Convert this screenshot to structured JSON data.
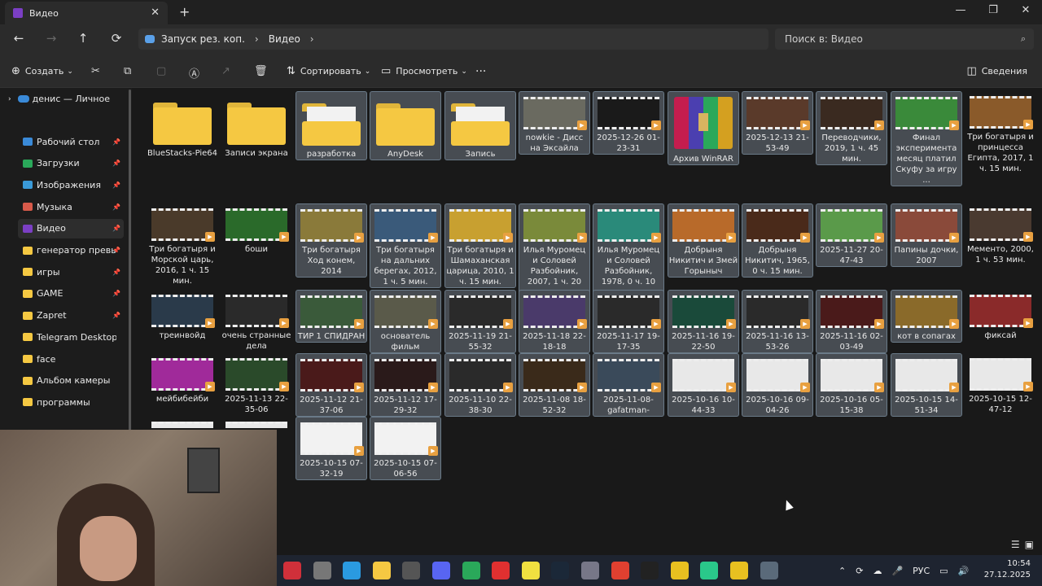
{
  "tab": {
    "title": "Видео",
    "close": "✕",
    "new": "+"
  },
  "window_controls": {
    "min": "—",
    "max": "❐",
    "close": "✕"
  },
  "nav": {
    "back": "←",
    "forward": "→",
    "up": "↑",
    "refresh": "⟳"
  },
  "breadcrumb": {
    "items": [
      "Запуск рез. коп.",
      "Видео"
    ],
    "sep": "›",
    "trail": "›"
  },
  "search": {
    "placeholder": "Поиск в: Видео",
    "icon": "⌕"
  },
  "toolbar": {
    "create": "Создать",
    "sort": "Сортировать",
    "view": "Просмотреть",
    "more": "···",
    "details": "Сведения",
    "caret": "⌄"
  },
  "sidebar": {
    "top": "денис — Личное",
    "items": [
      {
        "label": "Рабочий стол",
        "color": "#3a8ad8",
        "pin": true
      },
      {
        "label": "Загрузки",
        "color": "#2aa85a",
        "pin": true
      },
      {
        "label": "Изображения",
        "color": "#3a9ad8",
        "pin": true
      },
      {
        "label": "Музыка",
        "color": "#d85a4a",
        "pin": true
      },
      {
        "label": "Видео",
        "color": "#7b3fc4",
        "pin": true,
        "selected": true
      },
      {
        "label": "генератор превью к",
        "color": "#f5c842",
        "pin": true
      },
      {
        "label": "игры",
        "color": "#f5c842",
        "pin": true
      },
      {
        "label": "GAME",
        "color": "#f5c842",
        "pin": true
      },
      {
        "label": "Zapret",
        "color": "#f5c842",
        "pin": true
      },
      {
        "label": "Telegram Desktop",
        "color": "#f5c842",
        "pin": false
      },
      {
        "label": "face",
        "color": "#f5c842",
        "pin": false
      },
      {
        "label": "Альбом камеры",
        "color": "#f5c842",
        "pin": false
      },
      {
        "label": "программы",
        "color": "#f5c842",
        "pin": false
      }
    ],
    "pin_glyph": "📌"
  },
  "files": [
    {
      "name": "BlueStacks-Pie64",
      "kind": "folder",
      "sel": false
    },
    {
      "name": "Записи экрана",
      "kind": "folder",
      "sel": false
    },
    {
      "name": "разработка",
      "kind": "folder-doc",
      "sel": true
    },
    {
      "name": "AnyDesk",
      "kind": "folder",
      "sel": true
    },
    {
      "name": "Запись",
      "kind": "folder-doc",
      "sel": true
    },
    {
      "name": "nowkie - Дисс на Эксайла",
      "kind": "video",
      "sel": true,
      "tint": "#6a6a60"
    },
    {
      "name": "2025-12-26 01-23-31",
      "kind": "video",
      "sel": true,
      "tint": "#1a1a1a"
    },
    {
      "name": "Архив WinRAR",
      "kind": "rar",
      "sel": true
    },
    {
      "name": "2025-12-13 21-53-49",
      "kind": "video",
      "sel": true,
      "tint": "#5a3a2a"
    },
    {
      "name": "Переводчики, 2019, 1 ч. 45 мин.",
      "kind": "video",
      "sel": true,
      "tint": "#3a2a20"
    },
    {
      "name": "Финал эксперимента месяц платил Скуфу за игру ...",
      "kind": "video",
      "sel": true,
      "tint": "#3a8a3a"
    },
    {
      "name": "Три богатыря и принцесса Египта, 2017, 1 ч. 15 мин.",
      "kind": "video",
      "sel": false,
      "tint": "#8a5a2a"
    },
    {
      "name": "Три богатыря и Морской царь, 2016, 1 ч. 15 мин.",
      "kind": "video",
      "sel": false,
      "tint": "#4a3a2a"
    },
    {
      "name": "боши",
      "kind": "video",
      "sel": false,
      "tint": "#2a6a2a"
    },
    {
      "name": "Три богатыря Ход конем, 2014",
      "kind": "video",
      "sel": true,
      "tint": "#8a7a3a"
    },
    {
      "name": "Три богатыря на дальних берегах, 2012, 1 ч. 5 мин.",
      "kind": "video",
      "sel": true,
      "tint": "#3a5a7a"
    },
    {
      "name": "Три богатыря и Шамаханская царица, 2010, 1 ч. 15 мин.",
      "kind": "video",
      "sel": true,
      "tint": "#c8a030"
    },
    {
      "name": "Илья Муромец и Соловей Разбойник, 2007, 1 ч. 20 м...",
      "kind": "video",
      "sel": true,
      "tint": "#7a8a3a"
    },
    {
      "name": "Илья Муромец и Соловей Разбойник, 1978, 0 ч. 10 м...",
      "kind": "video",
      "sel": true,
      "tint": "#2a8a7a"
    },
    {
      "name": "Добрыня Никитич и Змей Горыныч",
      "kind": "video",
      "sel": true,
      "tint": "#b86a2a"
    },
    {
      "name": "Добрыня Никитич, 1965, 0 ч. 15 мин.",
      "kind": "video",
      "sel": true,
      "tint": "#4a2a1a"
    },
    {
      "name": "2025-11-27 20-47-43",
      "kind": "video",
      "sel": true,
      "tint": "#5a9a4a"
    },
    {
      "name": "Папины дочки, 2007",
      "kind": "video",
      "sel": true,
      "tint": "#8a4a3a"
    },
    {
      "name": "Мементо, 2000, 1 ч. 53 мин.",
      "kind": "video",
      "sel": false,
      "tint": "#4a3a30"
    },
    {
      "name": "треинвойд",
      "kind": "video",
      "sel": false,
      "tint": "#2a3a4a"
    },
    {
      "name": "очень странные дела",
      "kind": "video",
      "sel": false,
      "tint": "#2a2a2a"
    },
    {
      "name": "ТИР 1 СПИДРАН",
      "kind": "video",
      "sel": true,
      "tint": "#3a5a3a"
    },
    {
      "name": "основатель фильм",
      "kind": "video",
      "sel": true,
      "tint": "#5a5a4a"
    },
    {
      "name": "2025-11-19 21-55-32",
      "kind": "video",
      "sel": true,
      "tint": "#2a2a2a"
    },
    {
      "name": "2025-11-18 22-18-18",
      "kind": "video",
      "sel": true,
      "tint": "#4a3a6a"
    },
    {
      "name": "2025-11-17 19-17-35",
      "kind": "video",
      "sel": true,
      "tint": "#2a2a2a"
    },
    {
      "name": "2025-11-16 19-22-50",
      "kind": "video",
      "sel": true,
      "tint": "#1a4a3a"
    },
    {
      "name": "2025-11-16 13-53-26",
      "kind": "video",
      "sel": true,
      "tint": "#2a2a2a"
    },
    {
      "name": "2025-11-16 02-03-49",
      "kind": "video",
      "sel": true,
      "tint": "#4a1a1a"
    },
    {
      "name": "кот в сопагах",
      "kind": "video",
      "sel": true,
      "tint": "#8a6a2a"
    },
    {
      "name": "фиксай",
      "kind": "video",
      "sel": false,
      "tint": "#8a2a2a"
    },
    {
      "name": "мейбибейби",
      "kind": "video",
      "sel": false,
      "tint": "#a02a9a"
    },
    {
      "name": "2025-11-13 22-35-06",
      "kind": "video",
      "sel": false,
      "tint": "#2a4a2a"
    },
    {
      "name": "2025-11-12 21-37-06",
      "kind": "video",
      "sel": true,
      "tint": "#4a1a1a"
    },
    {
      "name": "2025-11-12 17-29-32",
      "kind": "video",
      "sel": true,
      "tint": "#2a1a1a"
    },
    {
      "name": "2025-11-10 22-38-30",
      "kind": "video",
      "sel": true,
      "tint": "#2a2a2a"
    },
    {
      "name": "2025-11-08 18-52-32",
      "kind": "video",
      "sel": true,
      "tint": "#3a2a1a"
    },
    {
      "name": "2025-11-08-gafatman-",
      "kind": "video",
      "sel": true,
      "tint": "#3a4a5a"
    },
    {
      "name": "2025-10-16 10-44-33",
      "kind": "video",
      "sel": true,
      "tint": "#e8e8e8"
    },
    {
      "name": "2025-10-16 09-04-26",
      "kind": "video",
      "sel": true,
      "tint": "#e8e8e8"
    },
    {
      "name": "2025-10-16 05-15-38",
      "kind": "video",
      "sel": true,
      "tint": "#e8e8e8"
    },
    {
      "name": "2025-10-15 14-51-34",
      "kind": "video",
      "sel": true,
      "tint": "#e8e8e8"
    },
    {
      "name": "2025-10-15 12-47-12",
      "kind": "video",
      "sel": false,
      "tint": "#e8e8e8"
    },
    {
      "name": "",
      "kind": "video",
      "sel": false,
      "tint": "#e8e8e8"
    },
    {
      "name": "",
      "kind": "video",
      "sel": false,
      "tint": "#e8e8e8"
    },
    {
      "name": "2025-10-15 07-32-19",
      "kind": "video",
      "sel": true,
      "tint": "#f2f2f2"
    },
    {
      "name": "2025-10-15 07-06-56",
      "kind": "video",
      "sel": true,
      "tint": "#f2f2f2"
    }
  ],
  "taskbar": {
    "apps": [
      {
        "name": "calendar",
        "color": "#d0303a"
      },
      {
        "name": "explorer-gray",
        "color": "#777"
      },
      {
        "name": "telegram",
        "color": "#2a9ae0"
      },
      {
        "name": "file-explorer",
        "color": "#f5c842"
      },
      {
        "name": "obs",
        "color": "#555"
      },
      {
        "name": "discord",
        "color": "#5865f2"
      },
      {
        "name": "green-app",
        "color": "#2aa85a"
      },
      {
        "name": "yandex",
        "color": "#e03030"
      },
      {
        "name": "sticky-notes",
        "color": "#f0e040"
      },
      {
        "name": "steam",
        "color": "#1b2838"
      },
      {
        "name": "settings",
        "color": "#778"
      },
      {
        "name": "chrome",
        "color": "#e04030"
      },
      {
        "name": "re-app",
        "color": "#222"
      },
      {
        "name": "starburst",
        "color": "#e8c020"
      },
      {
        "name": "green-box",
        "color": "#2ac88a"
      },
      {
        "name": "usb",
        "color": "#e8c020"
      },
      {
        "name": "calculator",
        "color": "#5a6a7a"
      }
    ],
    "tray": {
      "chevron": "⌃",
      "lang": "РУС"
    },
    "clock": {
      "time": "10:54",
      "date": "27.12.2025"
    }
  }
}
